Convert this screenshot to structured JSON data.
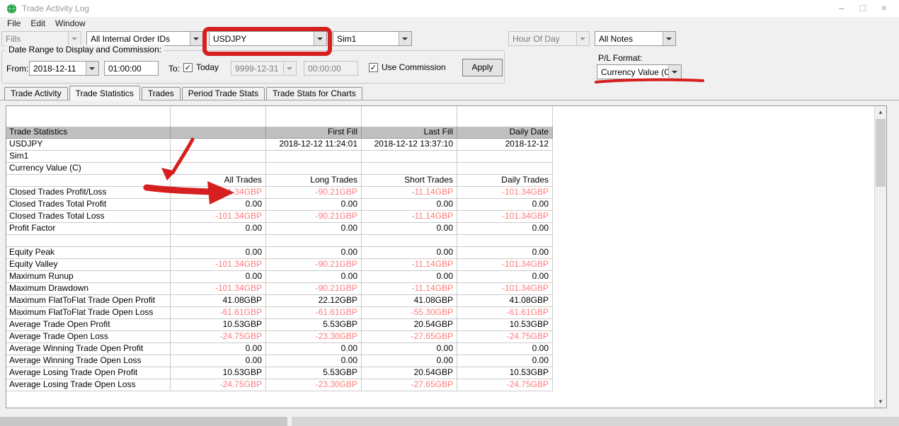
{
  "window": {
    "title": "Trade Activity Log",
    "menu": [
      "File",
      "Edit",
      "Window"
    ]
  },
  "toolbar": {
    "fills": "Fills",
    "order_ids": "All Internal Order IDs",
    "symbol": "USDJPY",
    "account": "Sim1",
    "hour_of_day": "Hour Of Day",
    "notes": "All Notes"
  },
  "date_range": {
    "group_title": "Date Range to Display and Commission:",
    "from_label": "From:",
    "from_date": "2018-12-11",
    "from_time": "01:00:00",
    "to_label": "To:",
    "today_label": "Today",
    "today_checked": true,
    "to_date": "9999-12-31",
    "to_time": "00:00:00",
    "use_commission_label": "Use Commission",
    "use_commission_checked": true,
    "apply_label": "Apply"
  },
  "pl_format": {
    "label": "P/L Format:",
    "value": "Currency Value (C)"
  },
  "tabs": [
    {
      "label": "Trade Activity",
      "active": false
    },
    {
      "label": "Trade Statistics",
      "active": true
    },
    {
      "label": "Trades",
      "active": false
    },
    {
      "label": "Period Trade Stats",
      "active": false
    },
    {
      "label": "Trade Stats for Charts",
      "active": false
    }
  ],
  "table": {
    "rows": [
      {
        "type": "spacer",
        "label": "",
        "cells": [
          "",
          "",
          "",
          ""
        ]
      },
      {
        "type": "header",
        "label": "Trade Statistics",
        "cells": [
          "",
          "First Fill",
          "Last Fill",
          "Daily Date"
        ]
      },
      {
        "type": "info",
        "label": "USDJPY",
        "cells": [
          "",
          "2018-12-12 11:24:01",
          "2018-12-12 13:37:10",
          "2018-12-12"
        ]
      },
      {
        "type": "info",
        "label": "Sim1",
        "cells": [
          "",
          "",
          "",
          ""
        ]
      },
      {
        "type": "info",
        "label": "Currency Value (C)",
        "cells": [
          "",
          "",
          "",
          ""
        ]
      },
      {
        "type": "colhead",
        "label": "",
        "cells": [
          "All Trades",
          "Long Trades",
          "Short Trades",
          "Daily Trades"
        ]
      },
      {
        "type": "stat",
        "label": "Closed Trades Profit/Loss",
        "cells": [
          "-101.34GBP",
          "-90.21GBP",
          "-11.14GBP",
          "-101.34GBP"
        ]
      },
      {
        "type": "stat",
        "label": "Closed Trades Total Profit",
        "cells": [
          "0.00",
          "0.00",
          "0.00",
          "0.00"
        ]
      },
      {
        "type": "stat",
        "label": "Closed Trades Total Loss",
        "cells": [
          "-101.34GBP",
          "-90.21GBP",
          "-11.14GBP",
          "-101.34GBP"
        ]
      },
      {
        "type": "stat",
        "label": "Profit Factor",
        "cells": [
          "0.00",
          "0.00",
          "0.00",
          "0.00"
        ]
      },
      {
        "type": "stat",
        "label": "",
        "cells": [
          "",
          "",
          "",
          ""
        ]
      },
      {
        "type": "stat",
        "label": "Equity Peak",
        "cells": [
          "0.00",
          "0.00",
          "0.00",
          "0.00"
        ]
      },
      {
        "type": "stat",
        "label": "Equity Valley",
        "cells": [
          "-101.34GBP",
          "-90.21GBP",
          "-11.14GBP",
          "-101.34GBP"
        ]
      },
      {
        "type": "stat",
        "label": "Maximum Runup",
        "cells": [
          "0.00",
          "0.00",
          "0.00",
          "0.00"
        ]
      },
      {
        "type": "stat",
        "label": "Maximum Drawdown",
        "cells": [
          "-101.34GBP",
          "-90.21GBP",
          "-11.14GBP",
          "-101.34GBP"
        ]
      },
      {
        "type": "stat",
        "label": "Maximum FlatToFlat Trade Open Profit",
        "cells": [
          "41.08GBP",
          "22.12GBP",
          "41.08GBP",
          "41.08GBP"
        ]
      },
      {
        "type": "stat",
        "label": "Maximum FlatToFlat Trade Open Loss",
        "cells": [
          "-61.61GBP",
          "-61.61GBP",
          "-55.30GBP",
          "-61.61GBP"
        ]
      },
      {
        "type": "stat",
        "label": "Average Trade Open Profit",
        "cells": [
          "10.53GBP",
          "5.53GBP",
          "20.54GBP",
          "10.53GBP"
        ]
      },
      {
        "type": "stat",
        "label": "Average Trade Open Loss",
        "cells": [
          "-24.75GBP",
          "-23.30GBP",
          "-27.65GBP",
          "-24.75GBP"
        ]
      },
      {
        "type": "stat",
        "label": "Average Winning Trade Open Profit",
        "cells": [
          "0.00",
          "0.00",
          "0.00",
          "0.00"
        ]
      },
      {
        "type": "stat",
        "label": "Average Winning Trade Open Loss",
        "cells": [
          "0.00",
          "0.00",
          "0.00",
          "0.00"
        ]
      },
      {
        "type": "stat",
        "label": "Average Losing Trade Open Profit",
        "cells": [
          "10.53GBP",
          "5.53GBP",
          "20.54GBP",
          "10.53GBP"
        ]
      },
      {
        "type": "stat",
        "label": "Average Losing Trade Open Loss",
        "cells": [
          "-24.75GBP",
          "-23.30GBP",
          "-27.65GBP",
          "-24.75GBP"
        ]
      }
    ]
  },
  "colors": {
    "negative_value": "#ff7a7a",
    "marker_annotation": "#d61f1f",
    "table_header_bg": "#c0c0c0"
  }
}
